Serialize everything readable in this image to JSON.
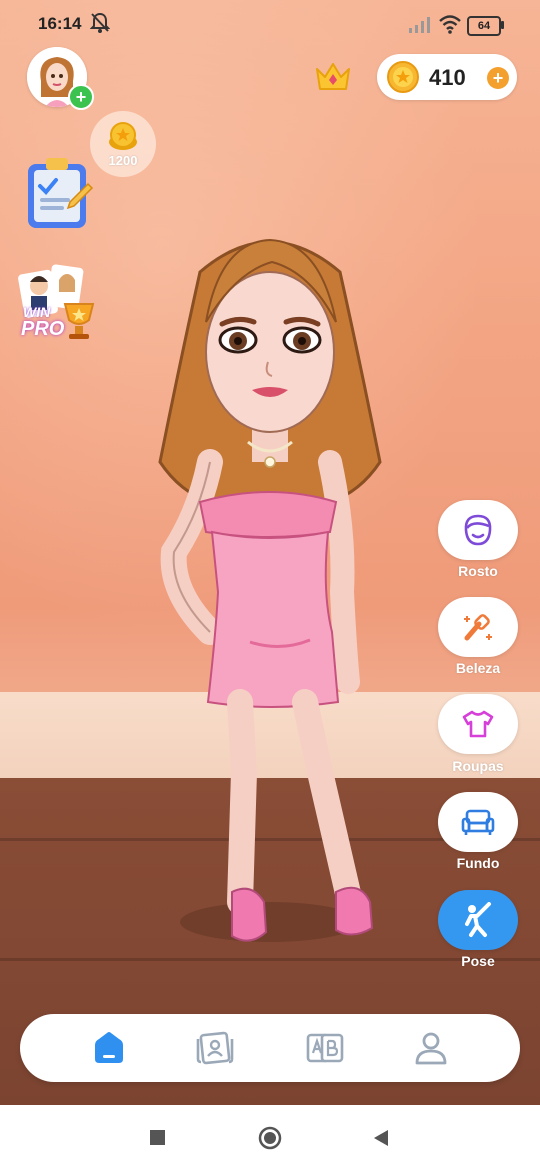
{
  "status_bar": {
    "time": "16:14",
    "battery": "64",
    "icons": [
      "bell-off-icon",
      "signal-icon",
      "wifi-icon",
      "battery-icon"
    ]
  },
  "header": {
    "coins": "410",
    "icons": [
      "profile-avatar",
      "add-icon",
      "crown-icon",
      "coin-icon",
      "add-coins-icon"
    ]
  },
  "reward_bubble": {
    "value": "1200"
  },
  "side_panel": {
    "items": [
      {
        "label": "Rosto",
        "icon": "face-icon"
      },
      {
        "label": "Beleza",
        "icon": "makeup-brush-icon"
      },
      {
        "label": "Roupas",
        "icon": "shirt-icon"
      },
      {
        "label": "Fundo",
        "icon": "sofa-icon"
      },
      {
        "label": "Pose",
        "icon": "pose-icon"
      }
    ]
  },
  "left_panel": {
    "winpro_label_1": "WIN",
    "winpro_label_2": "PRO"
  },
  "bottom_nav": {
    "items": [
      "home-icon",
      "cards-icon",
      "ab-icon",
      "profile-icon"
    ],
    "active": "home-icon"
  },
  "colors": {
    "accent": "#3498f0",
    "coin": "#f4a02e",
    "wall": "#f3a583",
    "floor": "#7b4431"
  }
}
